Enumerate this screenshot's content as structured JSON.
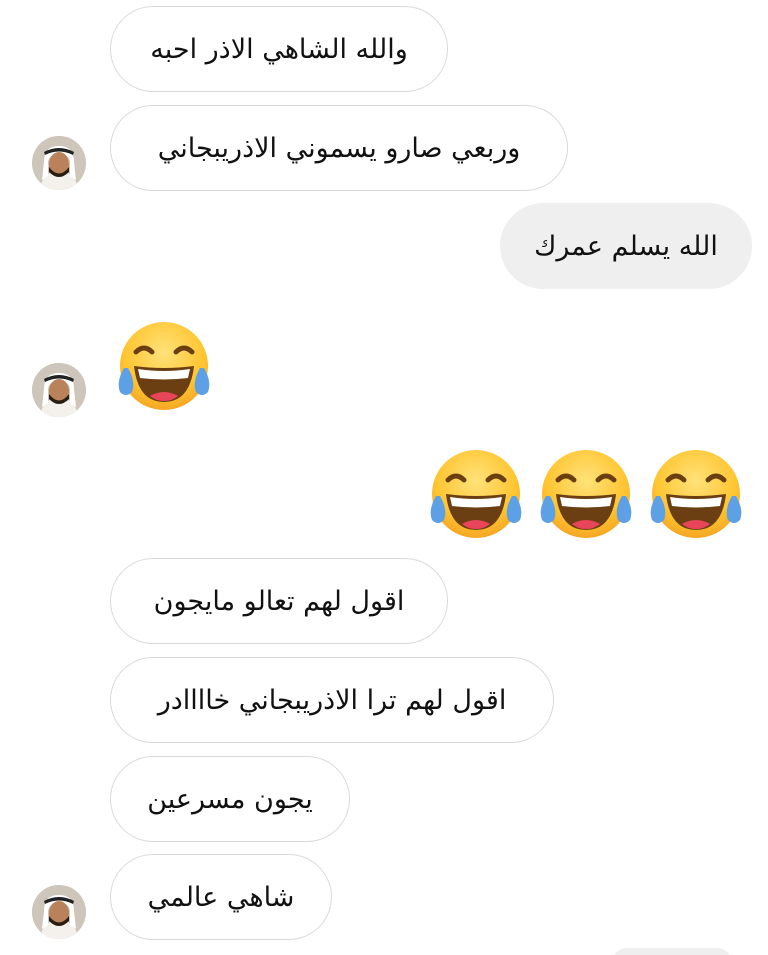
{
  "messages": [
    {
      "direction": "incoming",
      "text": "والله الشاهي الاذر احبه"
    },
    {
      "direction": "incoming",
      "text": "وربعي صارو يسموني الاذريبجاني"
    },
    {
      "direction": "outgoing",
      "text": "الله يسلم عمرك"
    },
    {
      "direction": "incoming",
      "emoji": "tears-of-joy-emoji",
      "count": 1
    },
    {
      "direction": "outgoing",
      "emoji": "tears-of-joy-emoji",
      "count": 3
    },
    {
      "direction": "incoming",
      "text": "اقول لهم تعالو مايجون"
    },
    {
      "direction": "incoming",
      "text": "اقول لهم ترا الاذريبجاني خاااادر"
    },
    {
      "direction": "incoming",
      "text": "يجون مسرعين"
    },
    {
      "direction": "incoming",
      "text": "شاهي عالمي"
    }
  ],
  "colors": {
    "incoming_bubble_bg": "#ffffff",
    "incoming_bubble_border": "#dadada",
    "outgoing_bubble_bg": "#efefef",
    "text": "#111111",
    "emoji_face": "#ffcc33",
    "emoji_tear": "#5ea0e6"
  },
  "icons": {
    "avatar": "user-avatar",
    "emoji": "face-with-tears-of-joy"
  }
}
